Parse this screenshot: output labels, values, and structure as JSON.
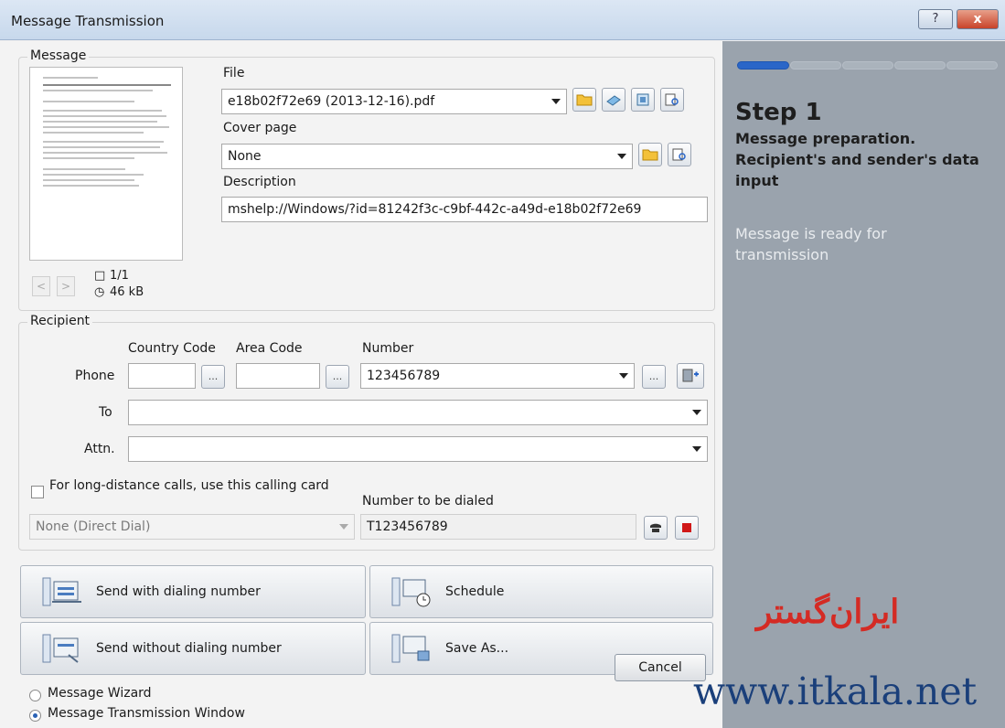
{
  "window": {
    "title": "Message Transmission",
    "help": "?",
    "close": "x"
  },
  "message": {
    "legend": "Message",
    "page_count": "1/1",
    "size": "46 kB",
    "prev": "<",
    "next": ">",
    "file_label": "File",
    "file_value": "e18b02f72e69 (2013-12-16).pdf",
    "cover_label": "Cover page",
    "cover_value": "None",
    "description_label": "Description",
    "description_value": "mshelp://Windows/?id=81242f3c-c9bf-442c-a49d-e18b02f72e69"
  },
  "recipient": {
    "legend": "Recipient",
    "country_code_label": "Country Code",
    "area_code_label": "Area Code",
    "number_label": "Number",
    "phone_label": "Phone",
    "number_value": "123456789",
    "to_label": "To",
    "attn_label": "Attn.",
    "dots": "...",
    "calling_card_label": "For long-distance calls, use this calling card",
    "calling_card_value": "None (Direct Dial)",
    "dialed_label": "Number to be dialed",
    "dialed_value": "T123456789"
  },
  "actions": {
    "send_with": "Send with dialing number",
    "schedule": "Schedule",
    "send_without": "Send without dialing number",
    "save_as": "Save As..."
  },
  "mode": {
    "wizard": "Message Wizard",
    "window": "Message Transmission Window"
  },
  "cancel": "Cancel",
  "steps": {
    "total": 5,
    "current": 1,
    "title": "Step 1",
    "subtitle": "Message preparation. Recipient's and sender's data input",
    "status": "Message is ready for transmission"
  },
  "overlay": {
    "logo_text": "ایران‌گستر",
    "watermark": "www.itkala.net"
  },
  "colors": {
    "accent": "#2a66c8",
    "panel": "#9aa3ad",
    "logo": "#d42b24"
  }
}
